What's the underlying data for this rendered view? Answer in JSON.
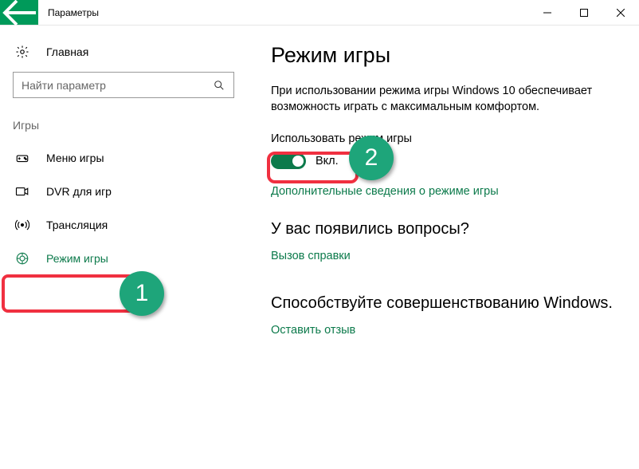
{
  "window": {
    "title": "Параметры"
  },
  "sidebar": {
    "home": "Главная",
    "search_placeholder": "Найти параметр",
    "group": "Игры",
    "items": [
      {
        "label": "Меню игры"
      },
      {
        "label": "DVR для игр"
      },
      {
        "label": "Трансляция"
      },
      {
        "label": "Режим игры"
      }
    ]
  },
  "content": {
    "title": "Режим игры",
    "description": "При использовании режима игры Windows 10 обеспечивает возможность играть с максимальным комфортом.",
    "toggle_label": "Использовать режим игры",
    "toggle_state": "Вкл.",
    "more_info_link": "Дополнительные сведения о режиме игры",
    "questions_heading": "У вас появились вопросы?",
    "help_link": "Вызов справки",
    "feedback_heading": "Способствуйте совершенствованию Windows.",
    "feedback_link": "Оставить отзыв"
  },
  "annotations": {
    "b1": "1",
    "b2": "2"
  }
}
